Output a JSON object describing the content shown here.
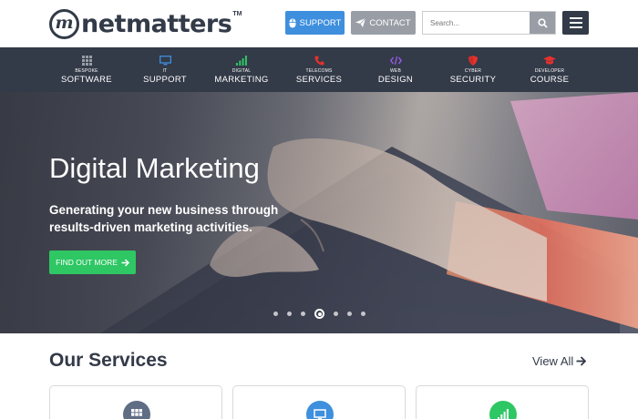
{
  "brand": {
    "name": "netmatters",
    "tm": "TM",
    "mark": "m"
  },
  "header": {
    "support_label": "SUPPORT",
    "contact_label": "CONTACT",
    "search_placeholder": "Search..."
  },
  "nav": [
    {
      "small": "BESPOKE",
      "big": "SOFTWARE",
      "icon": "grid-icon",
      "color": "#999ea6"
    },
    {
      "small": "IT",
      "big": "SUPPORT",
      "icon": "monitor-icon",
      "color": "#3e8fde"
    },
    {
      "small": "DIGITAL",
      "big": "MARKETING",
      "icon": "bar-chart-icon",
      "color": "#2ec764"
    },
    {
      "small": "TELECOMS",
      "big": "SERVICES",
      "icon": "phone-icon",
      "color": "#e4322e"
    },
    {
      "small": "WEB",
      "big": "DESIGN",
      "icon": "code-icon",
      "color": "#8e59d7"
    },
    {
      "small": "CYBER",
      "big": "SECURITY",
      "icon": "shield-icon",
      "color": "#e4322e"
    },
    {
      "small": "DEVELOPER",
      "big": "COURSE",
      "icon": "graduation-cap-icon",
      "color": "#e4322e"
    }
  ],
  "hero": {
    "title": "Digital Marketing",
    "subtitle": "Generating your new business through results-driven marketing activities.",
    "button_label": "FIND OUT MORE",
    "slide_count": 7,
    "active_slide": 4
  },
  "services": {
    "title": "Our Services",
    "view_all": "View All",
    "cards": [
      {
        "icon": "grid-icon",
        "color": "#5f6d85"
      },
      {
        "icon": "monitor-icon",
        "color": "#3e8fde"
      },
      {
        "icon": "bar-chart-icon",
        "color": "#2ec764"
      }
    ]
  },
  "colors": {
    "dark": "#333a48",
    "support": "#3e8fde",
    "contact": "#999ea6",
    "cta": "#2ec764"
  }
}
